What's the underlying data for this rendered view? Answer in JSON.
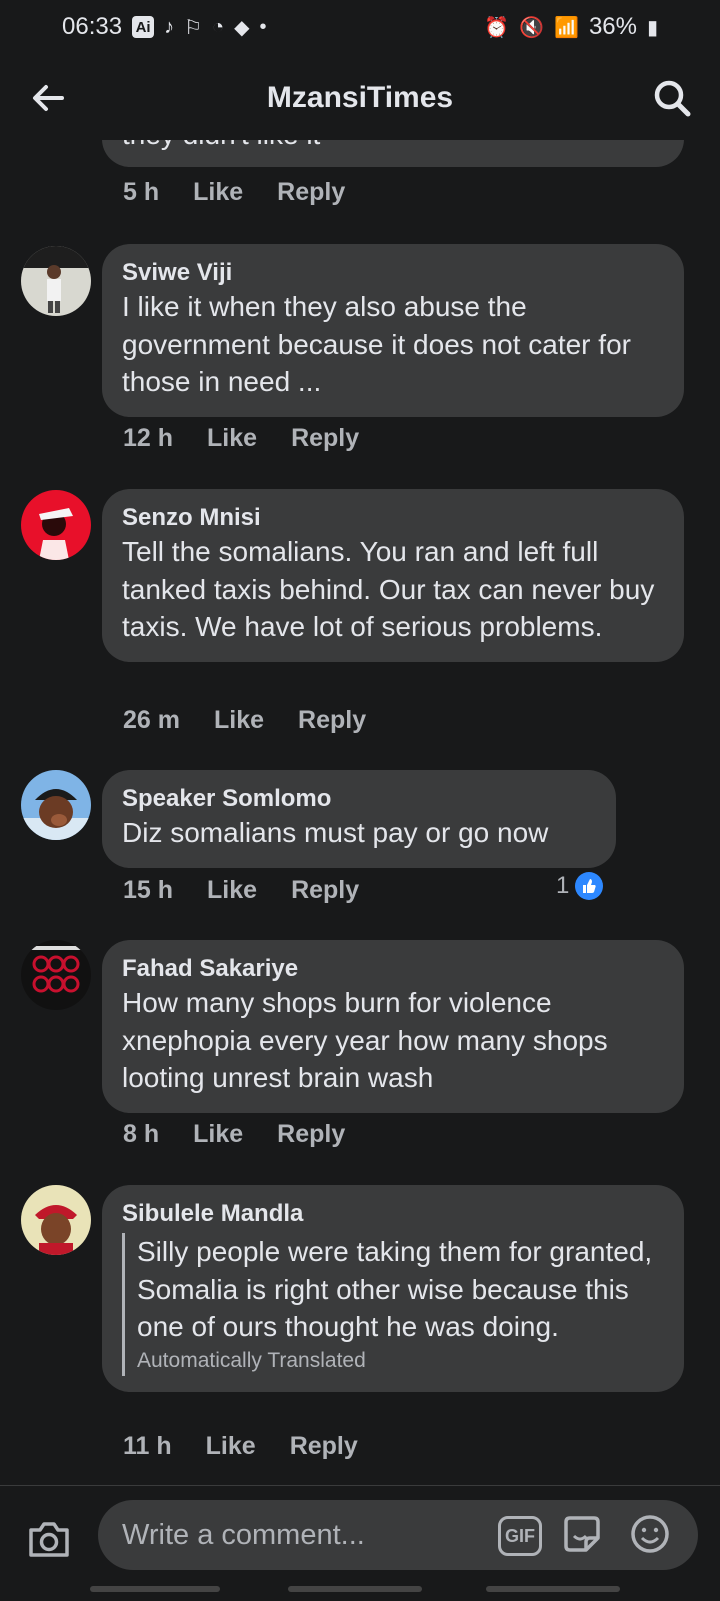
{
  "status_bar": {
    "time": "06:33",
    "battery": "36%"
  },
  "app_bar": {
    "title": "MzansiTimes"
  },
  "comments": [
    {
      "author": "",
      "text": "they didn't like it",
      "time": "5 h",
      "like_label": "Like",
      "reply_label": "Reply"
    },
    {
      "author": "Sviwe Viji",
      "text": "I like it when they also abuse the government because it does not cater for those in need ...",
      "time": "12 h",
      "like_label": "Like",
      "reply_label": "Reply"
    },
    {
      "author": "Senzo Mnisi",
      "text": "Tell the somalians. You ran and left full tanked taxis behind. Our tax can never buy taxis. We have lot of serious problems.",
      "time": "26 m",
      "like_label": "Like",
      "reply_label": "Reply"
    },
    {
      "author": "Speaker Somlomo",
      "text": "Diz somalians must pay or go now",
      "time": "15 h",
      "like_label": "Like",
      "reply_label": "Reply",
      "reaction_count": "1"
    },
    {
      "author": "Fahad Sakariye",
      "text": "How many shops burn for violence xnephopia every year  how many shops looting unrest   brain wash",
      "time": "8 h",
      "like_label": "Like",
      "reply_label": "Reply"
    },
    {
      "author": "Sibulele Mandla",
      "text": "Silly people were taking them for granted, Somalia is right other wise because this one of ours thought he was doing.",
      "translation_note": "Automatically Translated",
      "time": "11 h",
      "like_label": "Like",
      "reply_label": "Reply"
    }
  ],
  "composer": {
    "placeholder": "Write a comment...",
    "gif_label": "GIF"
  },
  "colors": {
    "background": "#18191a",
    "bubble": "#3a3b3c",
    "primary_text": "#e4e6eb",
    "secondary_text": "#b0b3b8",
    "like_blue": "#2d88ff"
  }
}
